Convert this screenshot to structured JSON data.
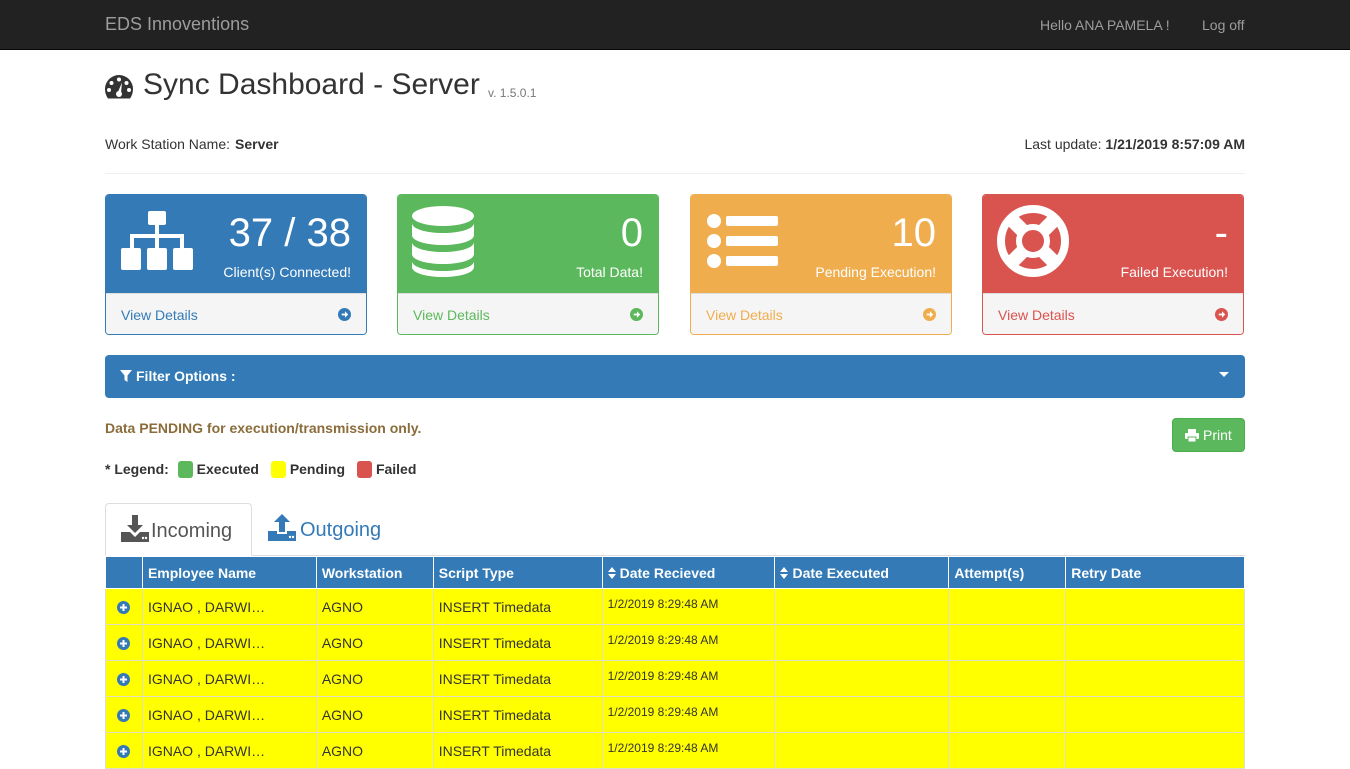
{
  "nav": {
    "brand": "EDS Innoventions",
    "greeting": "Hello ANA PAMELA !",
    "logoff": "Log off"
  },
  "header": {
    "title": "Sync Dashboard - Server",
    "version": "v. 1.5.0.1"
  },
  "workstation": {
    "label": "Work Station Name:",
    "value": "Server"
  },
  "last_update": {
    "label": "Last update:",
    "value": "1/21/2019 8:57:09 AM"
  },
  "panels": [
    {
      "value": "37 / 38",
      "label": "Client(s) Connected!",
      "link": "View Details",
      "icon": "sitemap-icon",
      "color": "#337ab7"
    },
    {
      "value": "0",
      "label": "Total Data!",
      "link": "View Details",
      "icon": "database-icon",
      "color": "#5cb85c"
    },
    {
      "value": "10",
      "label": "Pending Execution!",
      "link": "View Details",
      "icon": "list-icon",
      "color": "#f0ad4e"
    },
    {
      "value": "-",
      "label": "Failed Execution!",
      "link": "View Details",
      "icon": "life-ring-icon",
      "color": "#d9534f"
    }
  ],
  "filter": {
    "label": "Filter Options :"
  },
  "pending_note": "Data PENDING for execution/transmission only.",
  "print_label": "Print",
  "legend": {
    "title": "* Legend:",
    "items": [
      {
        "label": "Executed",
        "color": "#5cb85c"
      },
      {
        "label": "Pending",
        "color": "#ffff00"
      },
      {
        "label": "Failed",
        "color": "#d9534f"
      }
    ]
  },
  "tabs": [
    {
      "label": "Incoming",
      "icon": "download-icon"
    },
    {
      "label": "Outgoing",
      "icon": "upload-icon"
    }
  ],
  "table": {
    "columns": [
      "Employee Name",
      "Workstation",
      "Script Type",
      "Date Recieved",
      "Date Executed",
      "Attempt(s)",
      "Retry Date"
    ],
    "rows": [
      {
        "employee": "IGNAO , DARWI…",
        "workstation": "AGNO",
        "script": "INSERT Timedata",
        "received": "1/2/2019 8:29:48 AM",
        "executed": "",
        "attempts": "",
        "retry": ""
      },
      {
        "employee": "IGNAO , DARWI…",
        "workstation": "AGNO",
        "script": "INSERT Timedata",
        "received": "1/2/2019 8:29:48 AM",
        "executed": "",
        "attempts": "",
        "retry": ""
      },
      {
        "employee": "IGNAO , DARWI…",
        "workstation": "AGNO",
        "script": "INSERT Timedata",
        "received": "1/2/2019 8:29:48 AM",
        "executed": "",
        "attempts": "",
        "retry": ""
      },
      {
        "employee": "IGNAO , DARWI…",
        "workstation": "AGNO",
        "script": "INSERT Timedata",
        "received": "1/2/2019 8:29:48 AM",
        "executed": "",
        "attempts": "",
        "retry": ""
      },
      {
        "employee": "IGNAO , DARWI…",
        "workstation": "AGNO",
        "script": "INSERT Timedata",
        "received": "1/2/2019 8:29:48 AM",
        "executed": "",
        "attempts": "",
        "retry": ""
      }
    ]
  }
}
